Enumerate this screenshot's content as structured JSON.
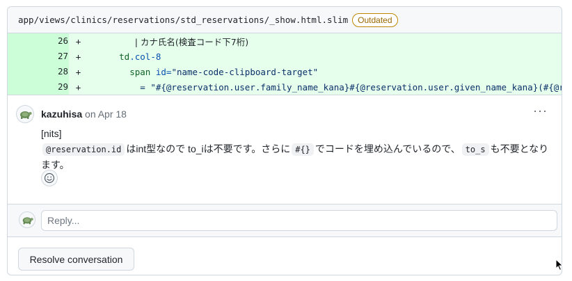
{
  "file": {
    "path": "app/views/clinics/reservations/std_reservations/_show.html.slim",
    "badge": "Outdated"
  },
  "diff_lines": [
    {
      "num": "26",
      "sign": "+",
      "indent": "         ",
      "text": "| カナ氏名(検査コード下7桁)"
    },
    {
      "num": "27",
      "sign": "+",
      "indent": "      ",
      "tag": "td",
      "attr": ".col-8"
    },
    {
      "num": "28",
      "sign": "+",
      "indent": "        ",
      "tag": "span",
      "attr": " id=",
      "str": "\"name-code-clipboard-target\""
    },
    {
      "num": "29",
      "sign": "+",
      "indent": "          ",
      "text": "= \"#{@reservation.user.family_name_kana}#{@reservation.user.given_name_kana}(#{@reservation"
    }
  ],
  "comment": {
    "author": "kazuhisa",
    "date": "on Apr 18",
    "more": "···",
    "line1": "[nits]",
    "code1": "@reservation.id",
    "text1": "はint型なので to_iは不要です。さらに",
    "code2": "#{}",
    "text2": "でコードを埋め込んでいるので、",
    "code3": "to_s",
    "text3": "も不要となり",
    "line3": "ます。"
  },
  "reply": {
    "placeholder": "Reply..."
  },
  "resolve": {
    "label": "Resolve conversation"
  },
  "icons": {
    "avatar": "turtle-avatar-icon",
    "emoji": "smiley-icon",
    "more": "kebab-horizontal-icon",
    "cursor": "mouse-pointer-icon"
  },
  "colors": {
    "diff_add_bg": "#e6ffec",
    "diff_add_num_bg": "#ccffd8",
    "badge": "#9a6700",
    "border": "#d0d7de"
  }
}
